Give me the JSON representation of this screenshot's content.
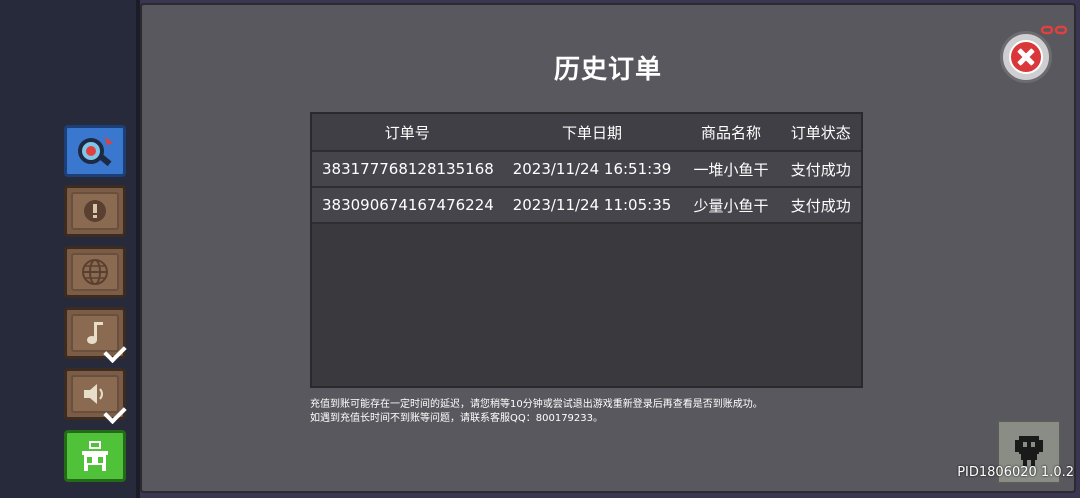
{
  "dialog": {
    "title": "历史订单"
  },
  "table": {
    "headers": [
      "订单号",
      "下单日期",
      "商品名称",
      "订单状态"
    ],
    "rows": [
      {
        "order_id": "383177768128135168",
        "date": "2023/11/24 16:51:39",
        "product": "一堆小鱼干",
        "status": "支付成功"
      },
      {
        "order_id": "383090674167476224",
        "date": "2023/11/24 11:05:35",
        "product": "少量小鱼干",
        "status": "支付成功"
      }
    ]
  },
  "notice": {
    "line1": "充值到账可能存在一定时间的延迟，请您稍等10分钟或尝试退出游戏重新登录后再查看是否到账成功。",
    "line2": "如遇到充值长时间不到账等问题，请联系客服QQ：800179233。"
  },
  "pid": "PID1806020 1.0.2",
  "side_buttons": [
    {
      "icon": "magnifier-icon",
      "color": "#3a78d0"
    },
    {
      "icon": "exclamation-icon",
      "color": "#7b5c46"
    },
    {
      "icon": "globe-icon",
      "color": "#7b5c46"
    },
    {
      "icon": "music-note-icon",
      "color": "#7b5c46",
      "checked": true
    },
    {
      "icon": "speaker-icon",
      "color": "#7b5c46",
      "checked": true
    },
    {
      "icon": "shop-icon",
      "color": "#4fc23a"
    }
  ],
  "colors": {
    "panel": "#59585e",
    "close": "#d9373a"
  }
}
